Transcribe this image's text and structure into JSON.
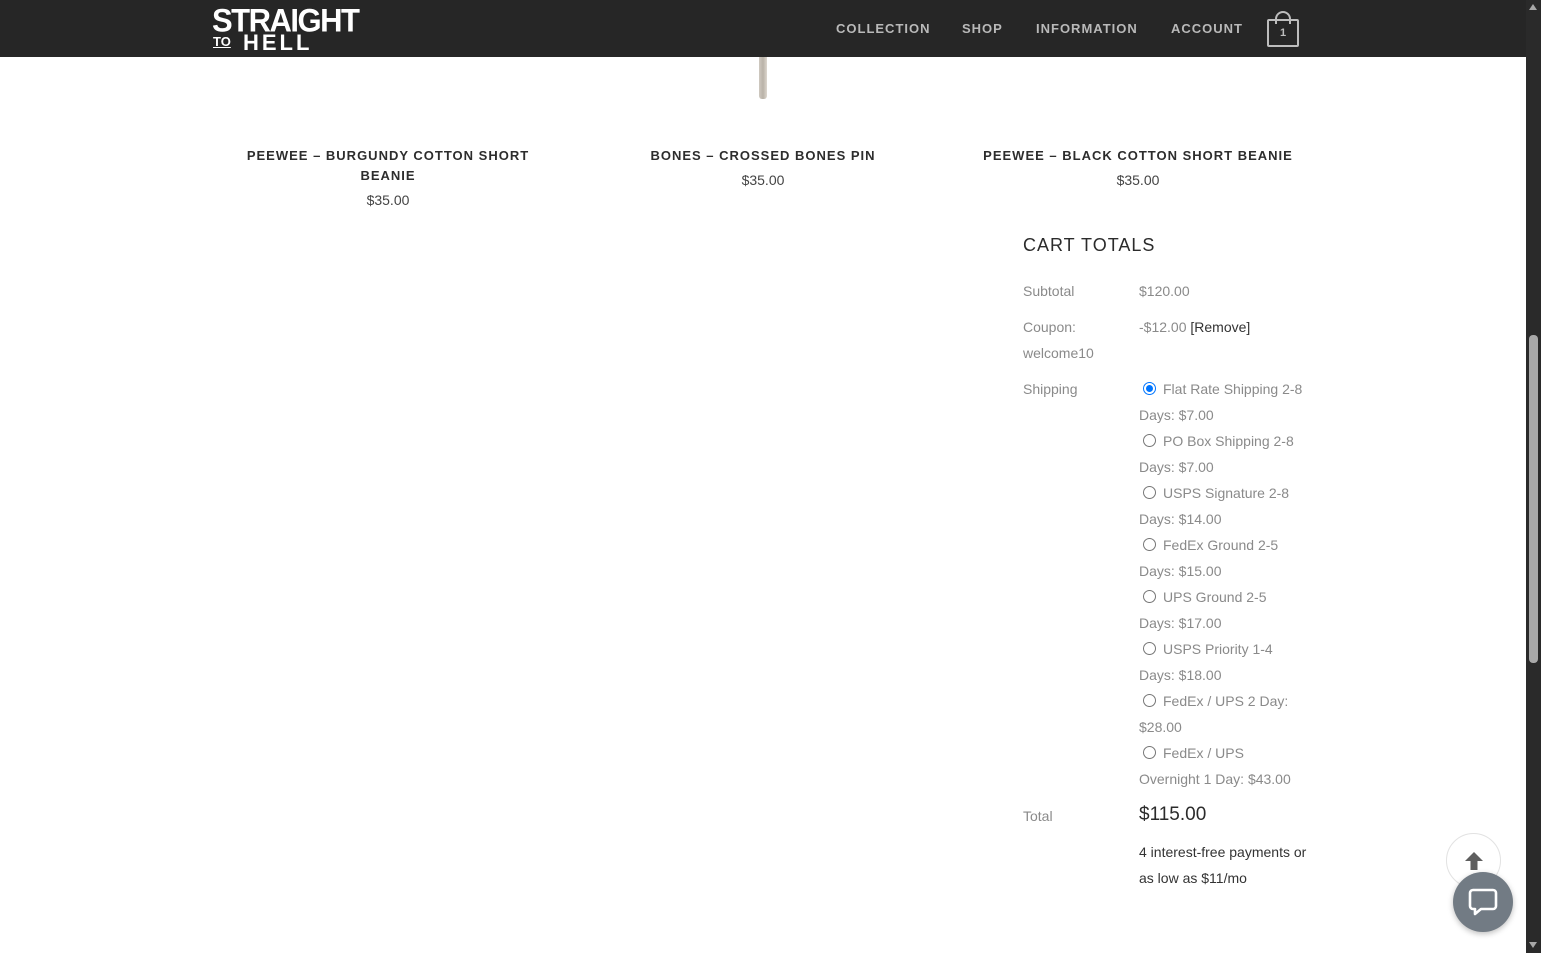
{
  "header": {
    "logo_line1": "STRAIGHT",
    "logo_line2a": "TO",
    "logo_line2b": "HELL",
    "nav": [
      "COLLECTION",
      "SHOP",
      "INFORMATION",
      "ACCOUNT"
    ],
    "cart_count": "1",
    "cart_icon": "shopping-bag-icon"
  },
  "products": [
    {
      "title": "PEEWEE – BURGUNDY COTTON SHORT BEANIE",
      "price": "$35.00"
    },
    {
      "title": "BONES – CROSSED BONES PIN",
      "price": "$35.00"
    },
    {
      "title": "PEEWEE – BLACK COTTON SHORT BEANIE",
      "price": "$35.00"
    }
  ],
  "cart_totals": {
    "heading": "CART TOTALS",
    "subtotal_label": "Subtotal",
    "subtotal_value": "$120.00",
    "coupon_label": "Coupon: welcome10",
    "coupon_value": "-$12.00",
    "coupon_remove": "[Remove]",
    "shipping_label": "Shipping",
    "shipping_options": [
      {
        "label": "Flat Rate Shipping 2-8 Days: $7.00",
        "selected": true
      },
      {
        "label": "PO Box Shipping 2-8 Days: $7.00",
        "selected": false
      },
      {
        "label": "USPS Signature 2-8 Days: $14.00",
        "selected": false
      },
      {
        "label": "FedEx Ground 2-5 Days: $15.00",
        "selected": false
      },
      {
        "label": "UPS Ground 2-5 Days: $17.00",
        "selected": false
      },
      {
        "label": "USPS Priority 1-4 Days: $18.00",
        "selected": false
      },
      {
        "label": "FedEx / UPS 2 Day: $28.00",
        "selected": false
      },
      {
        "label": "FedEx / UPS Overnight 1 Day: $43.00",
        "selected": false
      }
    ],
    "total_label": "Total",
    "total_value": "$115.00",
    "installments": "4 interest-free payments or as low as $11/mo"
  },
  "floating": {
    "back_to_top_icon": "arrow-up-icon",
    "chat_icon": "chat-bubble-icon"
  },
  "colors": {
    "header_bg": "#262626",
    "nav_text": "#b9b9b9",
    "radio_selected": "#0075ff",
    "chat_button": "#727b84"
  }
}
